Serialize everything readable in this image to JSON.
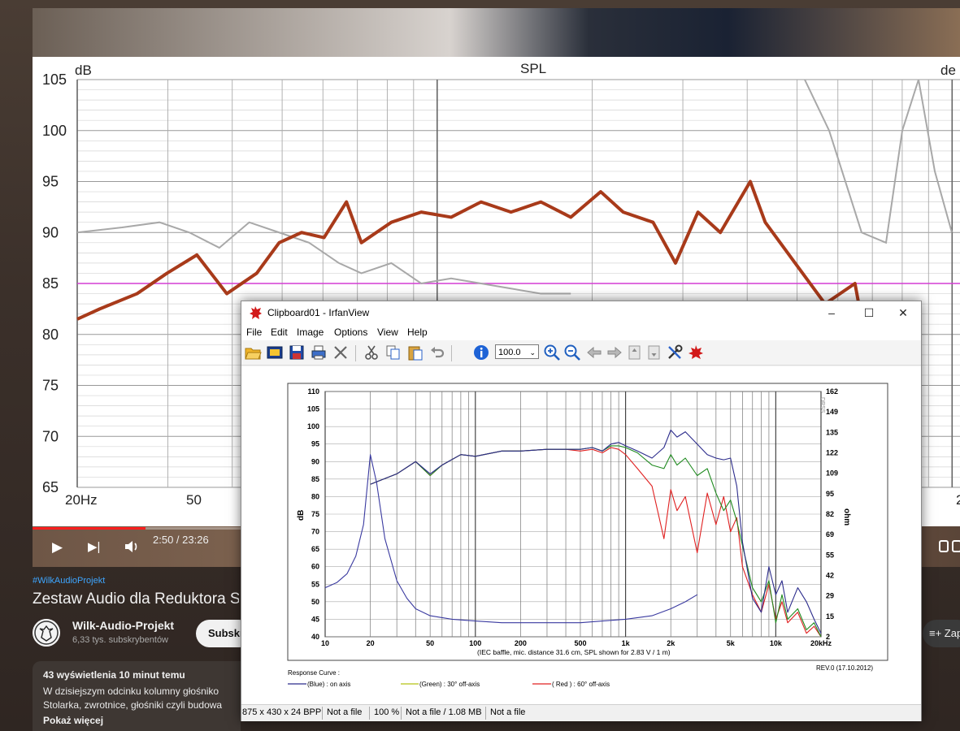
{
  "video": {
    "chart": {
      "title": "SPL",
      "ylabel": "dB",
      "right_label_partial": "de",
      "yticks": [
        105,
        100,
        95,
        90,
        85,
        80,
        75,
        70,
        65
      ],
      "xtick_labels": [
        "20Hz",
        "50"
      ],
      "xtick_partial": "2"
    },
    "time": "2:50 / 23:26",
    "progress": 0.122
  },
  "page": {
    "hashtag": "#WilkAudioProjekt",
    "title": "Zestaw Audio dla Reduktora Szu",
    "channel": "Wilk-Audio-Projekt",
    "subscribers": "6,33 tys. subskrybentów",
    "subscribe_label": "Subskr",
    "save_label": "Zap",
    "views": "43 wyświetlenia  10 minut temu",
    "desc_line1": "W dzisiejszym odcinku kolumny głośniko",
    "desc_line2": "Stolarka, zwrotnice, głośniki czyli budowa",
    "show_more": "Pokaż więcej"
  },
  "window": {
    "title": "Clipboard01 - IrfanView",
    "controls": {
      "minimize": "–",
      "maximize": "☐",
      "close": "✕"
    },
    "menu": [
      "File",
      "Edit",
      "Image",
      "Options",
      "View",
      "Help"
    ],
    "zoom_value": "100.0",
    "status": [
      "875 x 430 x 24 BPP",
      "Not a file",
      "100 %",
      "Not a file / 1.08 MB",
      "Not a file"
    ]
  },
  "chart_data": {
    "type": "line",
    "ylabel": "dB",
    "ylabel_right": "ohm",
    "ylim": [
      40,
      110
    ],
    "yticks": [
      40,
      45,
      50,
      55,
      60,
      65,
      70,
      75,
      80,
      85,
      90,
      95,
      100,
      105,
      110
    ],
    "right_ticks": [
      "2",
      "15",
      "29",
      "42",
      "55",
      "69",
      "82",
      "95",
      "109",
      "122",
      "135",
      "149",
      "162"
    ],
    "xscale": "log",
    "xlim": [
      10,
      20000
    ],
    "xtick_labels": [
      "10",
      "20",
      "50",
      "100",
      "200",
      "500",
      "1k",
      "2k",
      "5k",
      "10k",
      "20kHz"
    ],
    "xtick_values": [
      10,
      20,
      50,
      100,
      200,
      500,
      1000,
      2000,
      5000,
      10000,
      20000
    ],
    "note": "(IEC baffle, mic. distance 31.6 cm, SPL shown for 2.83 V / 1 m)",
    "watermark": "DRSS",
    "revision": "REV.0 (17.10.2012)",
    "legend_title": "Response Curve :",
    "legend_items": [
      "(Blue)  : on axis",
      "(Green) : 30° off-axis",
      "( Red )  : 60° off-axis"
    ],
    "grid": true,
    "colors": {
      "blue": "#2c2c8c",
      "green": "#1f8a1f",
      "red": "#e02020",
      "impedance": "#3a3aa0"
    },
    "series": [
      {
        "name": "(Blue)  : on axis",
        "x": [
          20,
          30,
          40,
          50,
          60,
          80,
          100,
          150,
          200,
          300,
          400,
          500,
          600,
          700,
          800,
          900,
          1000,
          1200,
          1500,
          1800,
          2000,
          2200,
          2500,
          3000,
          3500,
          4000,
          4500,
          5000,
          5500,
          6000,
          7000,
          8000,
          9000,
          10000,
          11000,
          12000,
          14000,
          16000,
          18000,
          20000
        ],
        "y": [
          83.5,
          86.5,
          90,
          86.5,
          89,
          92,
          91.5,
          93,
          93,
          93.5,
          93.5,
          93.5,
          94,
          93,
          95,
          95.5,
          94.5,
          93,
          91,
          94,
          99,
          97,
          98.5,
          95,
          92,
          91,
          90.5,
          91,
          83,
          67,
          51,
          47,
          60,
          52,
          56,
          47,
          54,
          50,
          45,
          41
        ]
      },
      {
        "name": "(Green) : 30° off-axis",
        "x": [
          20,
          30,
          40,
          50,
          60,
          80,
          100,
          150,
          200,
          300,
          400,
          500,
          600,
          700,
          800,
          900,
          1000,
          1200,
          1500,
          1800,
          2000,
          2200,
          2500,
          3000,
          3500,
          4000,
          4500,
          5000,
          5500,
          6000,
          7000,
          8000,
          9000,
          10000,
          11000,
          12000,
          14000,
          16000,
          18000,
          20000
        ],
        "y": [
          83.5,
          86.5,
          90,
          86,
          89,
          92,
          91.5,
          93,
          93,
          93.5,
          93.5,
          93.5,
          94,
          93,
          94.5,
          94.5,
          94,
          92.5,
          89,
          88,
          92,
          89,
          91,
          86,
          88,
          81,
          76,
          79,
          73,
          66,
          54,
          50,
          56,
          44,
          52,
          45,
          48,
          42,
          44,
          40
        ]
      },
      {
        "name": "( Red )  : 60° off-axis",
        "x": [
          20,
          30,
          40,
          50,
          60,
          80,
          100,
          150,
          200,
          300,
          400,
          500,
          600,
          700,
          800,
          900,
          1000,
          1200,
          1500,
          1800,
          2000,
          2200,
          2500,
          3000,
          3500,
          4000,
          4500,
          5000,
          5500,
          6000,
          7000,
          8000,
          9000,
          10000,
          11000,
          12000,
          14000,
          16000,
          18000,
          20000
        ],
        "y": [
          83.5,
          86.5,
          90,
          86,
          89,
          92,
          91.5,
          93,
          93,
          93.5,
          93.5,
          93,
          93.5,
          92.5,
          94,
          93.5,
          92,
          88,
          83,
          68,
          82,
          76,
          80,
          64,
          81,
          72,
          80,
          70,
          74,
          60,
          52,
          47,
          55,
          45,
          50,
          44,
          47,
          41,
          43,
          40
        ]
      },
      {
        "name": "impedance",
        "x": [
          10,
          12,
          14,
          16,
          18,
          20,
          22,
          25,
          30,
          35,
          40,
          50,
          70,
          100,
          150,
          200,
          300,
          500,
          700,
          1000,
          1500,
          2000,
          2500,
          3000
        ],
        "y": [
          54,
          55.5,
          58,
          63,
          72,
          92,
          84,
          68,
          56,
          51,
          48,
          46,
          45,
          44.5,
          44,
          44,
          44,
          44,
          44.5,
          45,
          46,
          48,
          50,
          52
        ]
      }
    ]
  }
}
